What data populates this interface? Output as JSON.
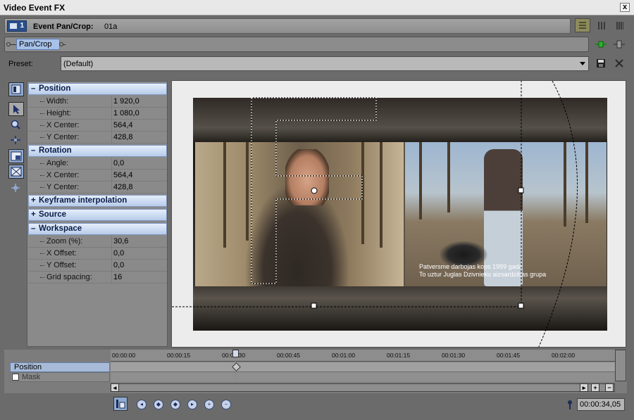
{
  "window": {
    "title": "Video Event FX",
    "close_glyph": "x"
  },
  "event_header": {
    "badge": "1",
    "label": "Event Pan/Crop:",
    "name": "01a"
  },
  "chain": {
    "plugin": "Pan/Crop"
  },
  "preset": {
    "label": "Preset:",
    "value": "(Default)"
  },
  "properties": {
    "position": {
      "title": "Position",
      "rows": [
        {
          "key": "Width:",
          "value": "1 920,0"
        },
        {
          "key": "Height:",
          "value": "1 080,0"
        },
        {
          "key": "X Center:",
          "value": "564,4"
        },
        {
          "key": "Y Center:",
          "value": "428,8"
        }
      ]
    },
    "rotation": {
      "title": "Rotation",
      "rows": [
        {
          "key": "Angle:",
          "value": "0,0"
        },
        {
          "key": "X Center:",
          "value": "564,4"
        },
        {
          "key": "Y Center:",
          "value": "428,8"
        }
      ]
    },
    "keyframe_interpolation": {
      "title": "Keyframe interpolation"
    },
    "source": {
      "title": "Source"
    },
    "workspace": {
      "title": "Workspace",
      "rows": [
        {
          "key": "Zoom (%):",
          "value": "30,6"
        },
        {
          "key": "X Offset:",
          "value": "0,0"
        },
        {
          "key": "Y Offset:",
          "value": "0,0"
        },
        {
          "key": "Grid spacing:",
          "value": "16"
        }
      ]
    }
  },
  "video": {
    "subtitle_line1": "Patversme darbojas kops 1999 gada",
    "subtitle_line2": "To uztur Juglas Dzivnieku aizsardzibas grupa"
  },
  "timeline": {
    "ticks": [
      "00:00:00",
      "00:00:15",
      "00:00:30",
      "00:00:45",
      "00:01:00",
      "00:01:15",
      "00:01:30",
      "00:01:45",
      "00:02:00"
    ],
    "tracks": {
      "position": "Position",
      "mask": "Mask"
    },
    "cursor_time": "00:00:34,05"
  }
}
